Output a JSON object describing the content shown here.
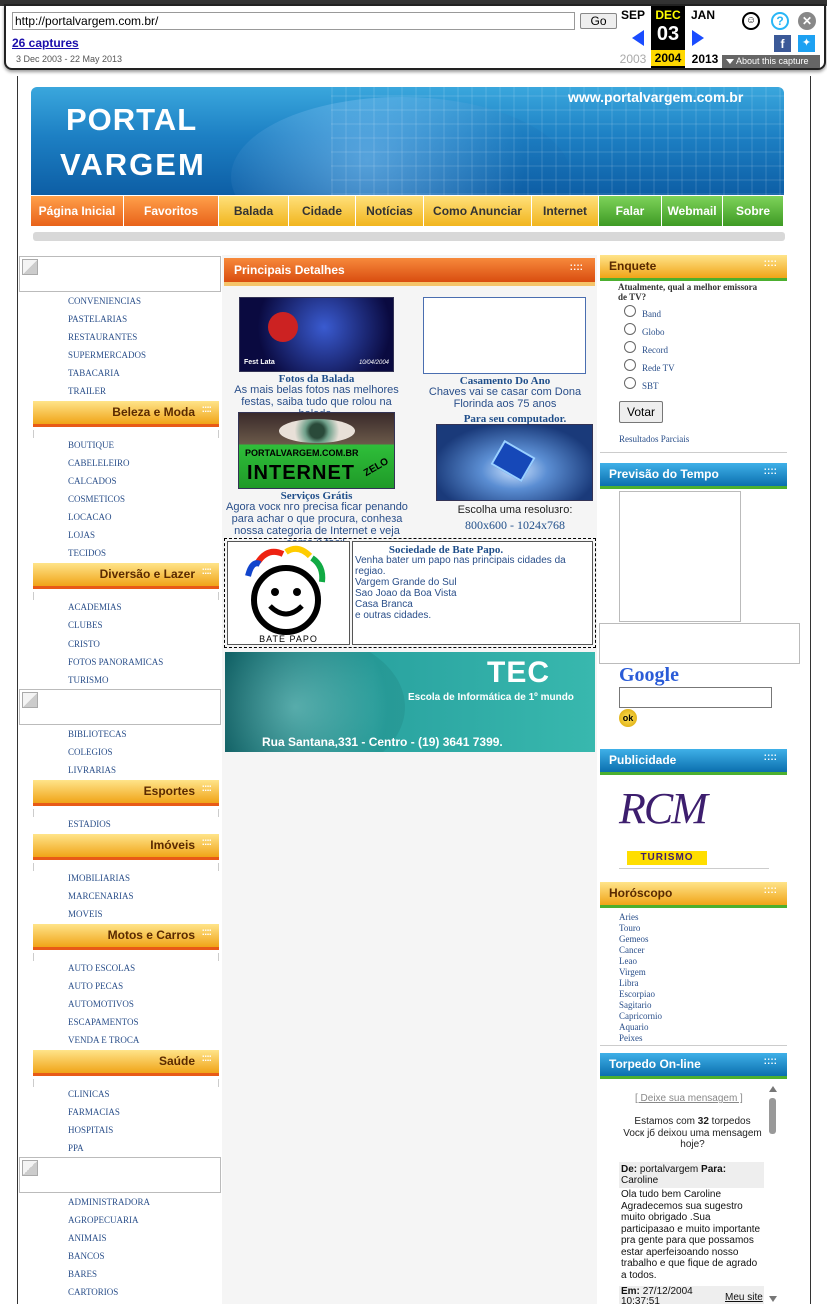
{
  "wayback": {
    "url": "http://portalvargem.com.br/",
    "go_label": "Go",
    "captures_label": "26 captures",
    "date_range": "3 Dec 2003 - 22 May 2013",
    "prev_month": "SEP",
    "cur_month": "DEC",
    "next_month": "JAN",
    "prev_year": "2003",
    "cur_day": "03",
    "cur_year": "2004",
    "next_year": "2013",
    "about_label": "About this capture"
  },
  "banner": {
    "brand_line1": "PORTAL",
    "brand_line2": "VARGEM",
    "site_url": "www.portalvargem.com.br"
  },
  "nav": [
    {
      "label": "Página Inicial",
      "style": "o",
      "w": 93
    },
    {
      "label": "Favoritos",
      "style": "o",
      "w": 95
    },
    {
      "label": "Balada",
      "style": "y",
      "w": 70
    },
    {
      "label": "Cidade",
      "style": "y",
      "w": 67
    },
    {
      "label": "Notícias",
      "style": "y",
      "w": 68
    },
    {
      "label": "Como Anunciar",
      "style": "y",
      "w": 108
    },
    {
      "label": "Internet",
      "style": "y",
      "w": 67
    },
    {
      "label": "Falar",
      "style": "g",
      "w": 63
    },
    {
      "label": "Webmail",
      "style": "g",
      "w": 61
    },
    {
      "label": "Sobre",
      "style": "g",
      "w": 61
    }
  ],
  "left": {
    "group1": [
      "CONVENIENCIAS",
      "PASTELARIAS",
      "RESTAURANTES",
      "SUPERMERCADOS",
      "TABACARIA",
      "TRAILER"
    ],
    "beleza_title": "Beleza e Moda",
    "beleza": [
      "BOUTIQUE",
      "CABELELEIRO",
      "CALCADOS",
      "COSMETICOS",
      "LOCACAO",
      "LOJAS",
      "TECIDOS"
    ],
    "diversao_title": "Diversão e Lazer",
    "diversao": [
      "ACADEMIAS",
      "CLUBES",
      "CRISTO",
      "FOTOS PANORAMICAS",
      "TURISMO"
    ],
    "educacao": [
      "BIBLIOTECAS",
      "COLEGIOS",
      "LIVRARIAS"
    ],
    "esportes_title": "Esportes",
    "esportes": [
      "ESTADIOS"
    ],
    "imoveis_title": "Imóveis",
    "imoveis": [
      "IMOBILIARIAS",
      "MARCENARIAS",
      "MOVEIS"
    ],
    "motos_title": "Motos e Carros",
    "motos": [
      "AUTO ESCOLAS",
      "AUTO PECAS",
      "AUTOMOTIVOS",
      "ESCAPAMENTOS",
      "VENDA E TROCA"
    ],
    "saude_title": "Saúde",
    "saude": [
      "CLINICAS",
      "FARMACIAS",
      "HOSPITAIS",
      "PPA"
    ],
    "servicos": [
      "ADMINISTRADORA",
      "AGROPECUARIA",
      "ANIMAIS",
      "BANCOS",
      "BARES",
      "CARTORIOS"
    ]
  },
  "center": {
    "header": "Principais Detalhes",
    "balada_photo_text": "Fest Lata",
    "balada_photo_date": "10/04/2004",
    "balada_title": "Fotos da Balada",
    "balada_desc": "As mais belas fotos nas melhores festas, saiba tudo que rolou na balada.",
    "casamento_title": "Casamento Do Ano",
    "casamento_desc": "Chaves vai se casar com Dona Florinda aos 75 anos",
    "internet_img_url": "PORTALVARGEM.COM.BR",
    "internet_img_word": "INTERNET",
    "internet_img_badge": "ZELO",
    "servicos_title": "Serviços Grátis",
    "servicos_desc": "Agora vocк nгo precisa ficar penando para achar o que procura, conheзa nossa categoria de Internet e veja como й facil.",
    "computador_title": "Para seu computador.",
    "resolucao_label": "Escolha uma resoluзгo:",
    "res_800": "800x600",
    "res_sep": " - ",
    "res_1024": "1024x768",
    "bate_papo_label": "BATE PAPO",
    "bate_title": "Sociedade de Bate Papo.",
    "bate_lines": [
      "Venha bater um papo nas principais cidades da regiao.",
      "Vargem Grande do Sul",
      "Sao Joao da Boa Vista",
      "Casa Branca",
      "e outras cidades."
    ],
    "tec_title": "TEC",
    "tec_sub": "Escola de Informática de 1º mundo",
    "tec_addr": "Rua Santana,331 - Centro - (19) 3641 7399."
  },
  "right": {
    "enquete_title": "Enquete",
    "enquete_question": "Atualmente, qual a melhor emissora de TV?",
    "options": [
      "Band",
      "Globo",
      "Record",
      "Rede TV",
      "SBT"
    ],
    "vote_label": "Votar",
    "results_label": "Resultados Parciais",
    "tempo_title": "Previsão do Tempo",
    "google_logo": "Google",
    "google_ok": "ok",
    "publicidade_title": "Publicidade",
    "ad_logo": "RCM",
    "ad_sub": "TURISMO",
    "horoscopo_title": "Horóscopo",
    "signs": [
      "Aries",
      "Touro",
      "Gemeos",
      "Cancer",
      "Leao",
      "Virgem",
      "Libra",
      "Escorpiao",
      "Sagitario",
      "Capricornio",
      "Aquario",
      "Peixes"
    ],
    "torpedo_title": "Torpedo On-line",
    "torpedo_link": "[ Deixe sua mensagem ]",
    "torpedo_count_pre": "Estamos com ",
    "torpedo_count": "32",
    "torpedo_count_post": " torpedos",
    "torpedo_ask": "Vocк jб deixou uma mensagem hoje?",
    "msg_de_label": "De:",
    "msg_from": "portalvargem",
    "msg_para_label": "Para:",
    "msg_to": "Caroline",
    "msg_body": "Ola tudo bem  Caroline Agradecemos sua sugestro muito obrigado .Sua participaзao e muito importante pra gente para que possamos estar aperfeiзoando nosso trabalho e que fique de agrado a todos.",
    "msg_em_label": "Em:",
    "msg_date": "27/12/2004",
    "msg_time": "10:37:51",
    "msg_site": "Meu site"
  }
}
